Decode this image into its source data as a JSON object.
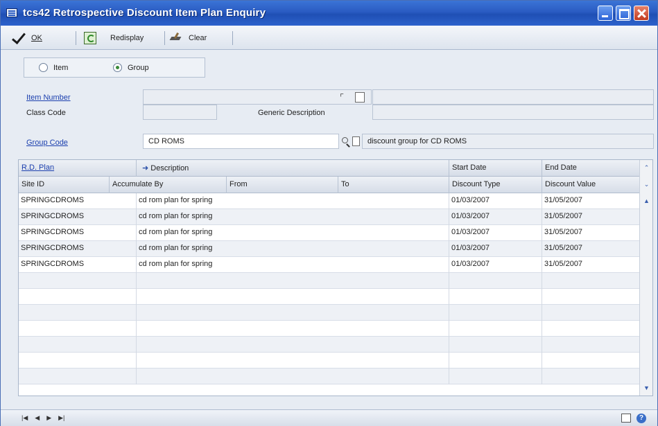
{
  "window": {
    "title": "tcs42 Retrospective Discount Item Plan Enquiry"
  },
  "toolbar": {
    "ok": "OK",
    "redisplay": "Redisplay",
    "clear": "Clear"
  },
  "selection": {
    "item_label": "Item",
    "group_label": "Group",
    "selected": "Group"
  },
  "fields": {
    "item_number_label": "Item Number",
    "class_code_label": "Class Code",
    "generic_description_label": "Generic Description",
    "group_code_label": "Group Code",
    "group_code_value": "CD ROMS",
    "group_description_value": "discount group for CD ROMS"
  },
  "grid": {
    "header1": {
      "rd_plan": "R.D. Plan",
      "description": "Description",
      "start_date": "Start Date",
      "end_date": "End Date"
    },
    "header2": {
      "site_id": "Site ID",
      "accumulate_by": "Accumulate By",
      "from": "From",
      "to": "To",
      "discount_type": "Discount Type",
      "discount_value": "Discount Value"
    },
    "rows": [
      {
        "plan": "SPRINGCDROMS",
        "description": "cd rom plan for spring",
        "start": "01/03/2007",
        "end": "31/05/2007"
      },
      {
        "plan": "SPRINGCDROMS",
        "description": "cd rom plan for spring",
        "start": "01/03/2007",
        "end": "31/05/2007"
      },
      {
        "plan": "SPRINGCDROMS",
        "description": "cd rom plan for spring",
        "start": "01/03/2007",
        "end": "31/05/2007"
      },
      {
        "plan": "SPRINGCDROMS",
        "description": "cd rom plan for spring",
        "start": "01/03/2007",
        "end": "31/05/2007"
      },
      {
        "plan": "SPRINGCDROMS",
        "description": "cd rom plan for spring",
        "start": "01/03/2007",
        "end": "31/05/2007"
      }
    ]
  },
  "icons": {
    "ok": "check-icon",
    "redisplay": "redisplay-icon",
    "clear": "eraser-icon",
    "lookup": "lookup-icon",
    "note": "note-icon",
    "sort": "sort-arrow-icon"
  }
}
